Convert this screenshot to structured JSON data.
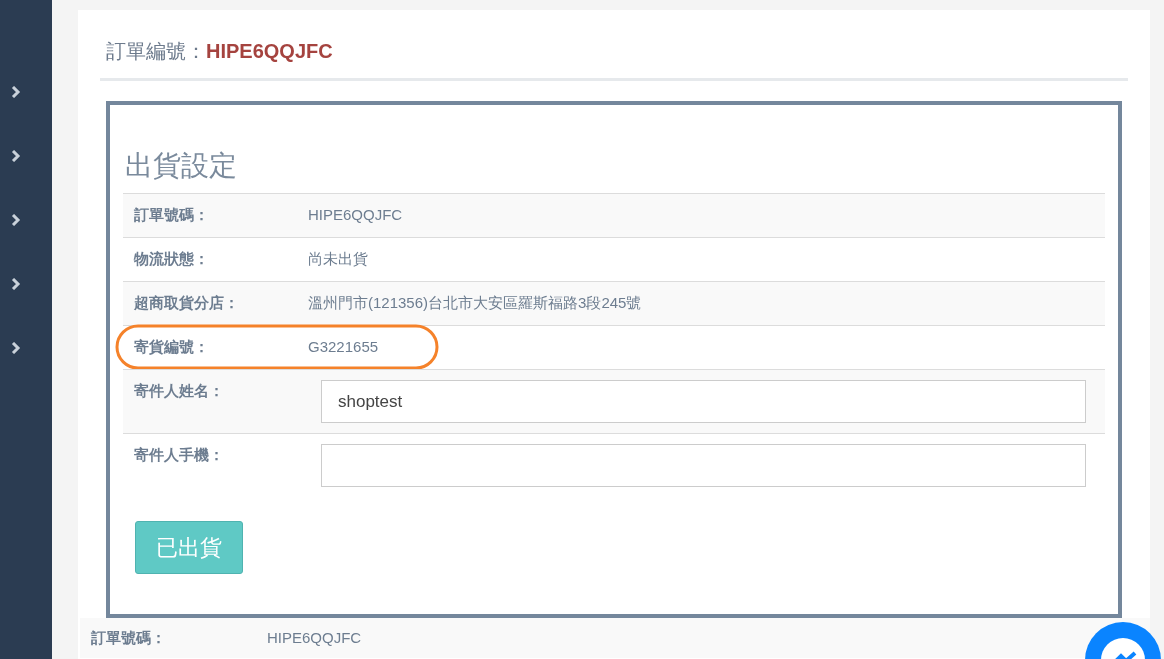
{
  "sidebar": {
    "items": [
      {
        "expanded": false
      },
      {
        "expanded": false
      },
      {
        "expanded": false
      },
      {
        "expanded": false
      },
      {
        "expanded": false
      }
    ]
  },
  "page_title": {
    "label": "訂單編號：",
    "value": "HIPE6QQJFC"
  },
  "shipping_panel": {
    "title": "出貨設定",
    "rows": [
      {
        "kind": "text",
        "label": "訂單號碼：",
        "value": "HIPE6QQJFC",
        "highlighted": false
      },
      {
        "kind": "text",
        "label": "物流狀態：",
        "value": "尚未出貨",
        "highlighted": false
      },
      {
        "kind": "text",
        "label": "超商取貨分店：",
        "value": "溫州門市(121356)台北市大安區羅斯福路3段245號",
        "highlighted": false
      },
      {
        "kind": "text",
        "label": "寄貨編號：",
        "value": "G3221655",
        "highlighted": true
      },
      {
        "kind": "input",
        "label": "寄件人姓名：",
        "value": "shoptest"
      },
      {
        "kind": "input",
        "label": "寄件人手機："
      }
    ],
    "button": "已出貨"
  },
  "order_rows": [
    {
      "label": "訂單號碼：",
      "value": "HIPE6QQJFC"
    }
  ]
}
